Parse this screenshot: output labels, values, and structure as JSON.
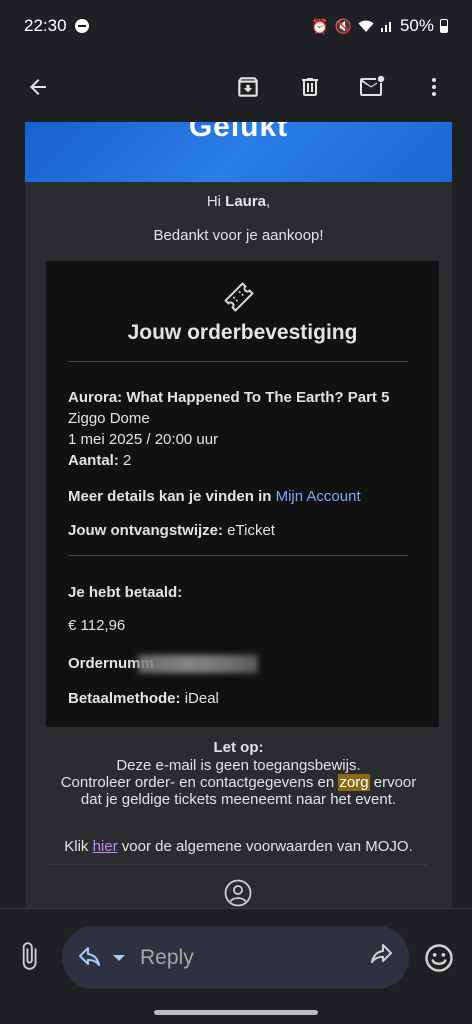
{
  "status_bar": {
    "time": "22:30",
    "battery": "50%"
  },
  "email": {
    "banner_title": "Gelukt",
    "greeting_prefix": "Hi ",
    "greeting_name": "Laura",
    "greeting_suffix": ",",
    "thanks": "Bedankt voor je aankoop!",
    "order": {
      "title": "Jouw orderbevestiging",
      "event_name": "Aurora: What Happened To The Earth? Part 5",
      "venue": "Ziggo Dome",
      "datetime": "1 mei 2025 / 20:00 uur",
      "quantity_label": "Aantal:",
      "quantity_value": " 2",
      "details_label": "Meer details kan je vinden in ",
      "details_link": "Mijn Account",
      "delivery_label": "Jouw ontvangstwijze:",
      "delivery_value": " eTicket",
      "paid_label": "Je hebt betaald:",
      "paid_amount": "€ 112,96",
      "ordernumber_label": "Ordernumm",
      "payment_label": "Betaalmethode:",
      "payment_value": " iDeal"
    },
    "notice": {
      "heading": "Let op:",
      "line1": "Deze e-mail is geen toegangsbewijs.",
      "line2_before": "Controleer order- en contactgegevens en ",
      "line2_highlight": "zorg",
      "line2_after": " ervoor",
      "line3": "dat je geldige tickets meeneemt naar het event."
    },
    "terms": {
      "before": "Klik ",
      "link": "hier",
      "after": " voor de algemene voorwaarden van MOJO."
    }
  },
  "reply_bar": {
    "reply_label": "Reply"
  },
  "colors": {
    "background": "#1f2023",
    "card": "#2b2c2f",
    "order_box": "#111111",
    "link": "#7cacf8",
    "highlight": "#8a6a12",
    "visited_link": "#c58af9",
    "banner": "#2b7de8"
  },
  "icons": [
    "back-arrow-icon",
    "archive-icon",
    "delete-icon",
    "mark-unread-icon",
    "more-vert-icon",
    "ticket-icon",
    "user-circle-icon",
    "attach-icon",
    "reply-icon",
    "dropdown-icon",
    "forward-icon",
    "emoji-icon"
  ]
}
